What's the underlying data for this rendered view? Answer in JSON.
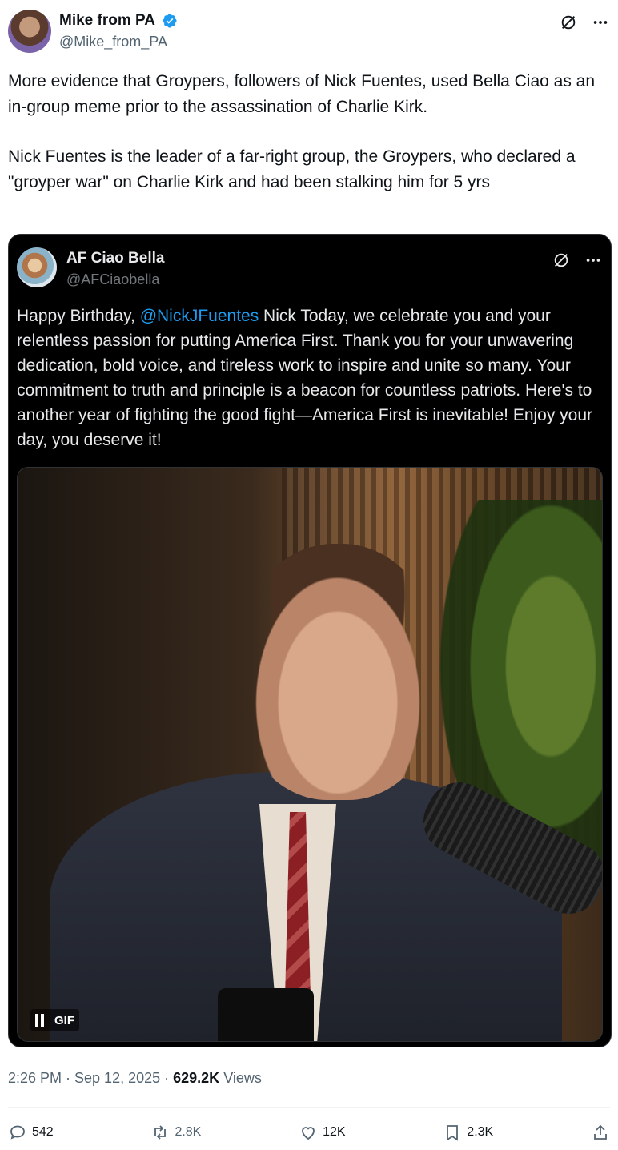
{
  "post": {
    "author": {
      "display_name": "Mike from PA",
      "handle": "@Mike_from_PA",
      "verified": true
    },
    "paragraphs": [
      "More evidence that Groypers, followers of Nick Fuentes, used Bella Ciao as an in-group meme prior to the assassination of Charlie Kirk.",
      "Nick Fuentes is the leader of a far-right group, the Groypers, who declared a \"groyper war\" on Charlie Kirk and had been stalking him for 5 yrs"
    ],
    "timestamp": "2:26 PM · Sep 12, 2025",
    "views_count": "629.2K",
    "views_label": "Views"
  },
  "quote": {
    "author": {
      "display_name": "AF Ciao Bella",
      "handle": "@AFCiaobella"
    },
    "text_prefix": "Happy Birthday, ",
    "mention": "@NickJFuentes",
    "text_suffix": " Nick  Today, we celebrate you and your relentless passion for putting America First. Thank you for your unwavering dedication, bold voice, and tireless work to inspire and unite so many. Your commitment to truth and principle is a beacon for countless patriots. Here's to another year of fighting the good fight—America First is inevitable!  Enjoy your day, you deserve it!",
    "media": {
      "badge": "GIF"
    }
  },
  "actions": {
    "replies": "542",
    "reposts": "2.8K",
    "likes": "12K",
    "bookmarks": "2.3K"
  },
  "colors": {
    "verified": "#1d9bf0",
    "mention": "#1d9bf0",
    "muted": "#536471"
  },
  "icons": [
    "verified-badge-icon",
    "grok-icon",
    "more-icon",
    "pause-icon",
    "reply-icon",
    "repost-icon",
    "like-icon",
    "bookmark-icon",
    "share-icon"
  ]
}
